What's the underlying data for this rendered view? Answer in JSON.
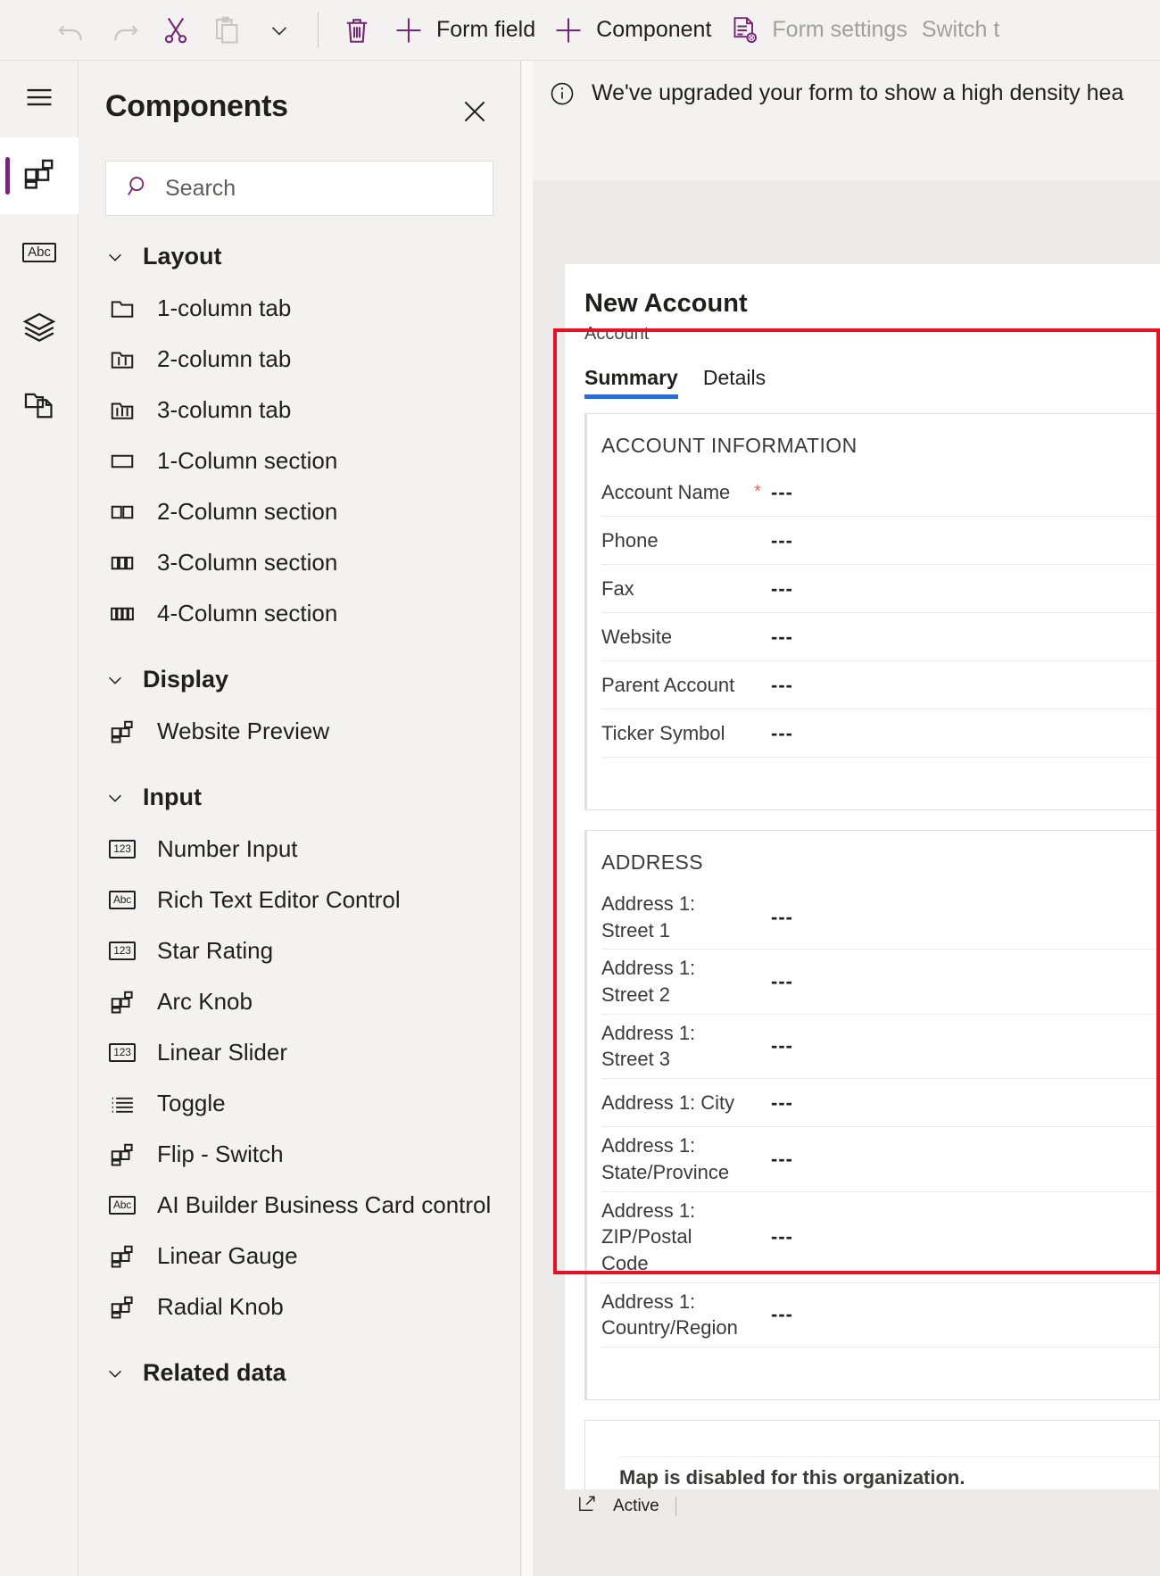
{
  "toolbar": {
    "items": [
      {
        "name": "undo",
        "label": "",
        "icon": "undo-icon",
        "disabled": true
      },
      {
        "name": "redo",
        "label": "",
        "icon": "redo-icon",
        "disabled": true
      },
      {
        "name": "cut",
        "label": "",
        "icon": "scissors-icon",
        "disabled": false
      },
      {
        "name": "paste",
        "label": "",
        "icon": "clipboard-icon",
        "disabled": true
      },
      {
        "name": "overflow",
        "label": "",
        "icon": "chevron-down-icon",
        "disabled": false
      },
      {
        "name": "delete",
        "label": "",
        "icon": "trash-icon",
        "disabled": false
      },
      {
        "name": "form-field",
        "label": "Form field",
        "icon": "plus-icon",
        "disabled": false
      },
      {
        "name": "component",
        "label": "Component",
        "icon": "plus-icon",
        "disabled": false
      },
      {
        "name": "form-settings",
        "label": "Form settings",
        "icon": "form-settings-icon",
        "disabled": true
      },
      {
        "name": "switch",
        "label": "Switch t",
        "icon": "",
        "disabled": true
      }
    ]
  },
  "rail": {
    "items": [
      {
        "name": "menu",
        "icon": "hamburger-icon",
        "selected": false
      },
      {
        "name": "components",
        "icon": "components-grid-icon",
        "selected": true
      },
      {
        "name": "fields",
        "icon": "abc-field-icon",
        "selected": false
      },
      {
        "name": "layers",
        "icon": "layers-icon",
        "selected": false
      },
      {
        "name": "pages",
        "icon": "copy-pages-icon",
        "selected": false
      }
    ]
  },
  "panel": {
    "title": "Components",
    "close_label": "Close",
    "search": {
      "placeholder": "Search",
      "value": ""
    },
    "groups": [
      {
        "title": "Layout",
        "expanded": true,
        "items": [
          {
            "label": "1-column tab",
            "icon": "tab-1col-icon"
          },
          {
            "label": "2-column tab",
            "icon": "tab-2col-icon"
          },
          {
            "label": "3-column tab",
            "icon": "tab-3col-icon"
          },
          {
            "label": "1-Column section",
            "icon": "section-1col-icon"
          },
          {
            "label": "2-Column section",
            "icon": "section-2col-icon"
          },
          {
            "label": "3-Column section",
            "icon": "section-3col-icon"
          },
          {
            "label": "4-Column section",
            "icon": "section-4col-icon"
          }
        ]
      },
      {
        "title": "Display",
        "expanded": true,
        "items": [
          {
            "label": "Website Preview",
            "icon": "components-grid-icon"
          }
        ]
      },
      {
        "title": "Input",
        "expanded": true,
        "items": [
          {
            "label": "Number Input",
            "icon": "number-123-icon"
          },
          {
            "label": "Rich Text Editor Control",
            "icon": "abc-text-icon"
          },
          {
            "label": "Star Rating",
            "icon": "number-123-icon"
          },
          {
            "label": "Arc Knob",
            "icon": "components-grid-icon"
          },
          {
            "label": "Linear Slider",
            "icon": "number-123-icon"
          },
          {
            "label": "Toggle",
            "icon": "list-lines-icon"
          },
          {
            "label": "Flip - Switch",
            "icon": "components-grid-icon"
          },
          {
            "label": "AI Builder Business Card control",
            "icon": "abc-text-icon"
          },
          {
            "label": "Linear Gauge",
            "icon": "components-grid-icon"
          },
          {
            "label": "Radial Knob",
            "icon": "components-grid-icon"
          }
        ]
      },
      {
        "title": "Related data",
        "expanded": true,
        "items": []
      }
    ]
  },
  "canvas": {
    "banner": {
      "icon": "info-icon",
      "text": "We've upgraded your form to show a high density hea"
    },
    "form": {
      "title": "New Account",
      "subtitle": "Account",
      "tabs": [
        {
          "label": "Summary",
          "active": true
        },
        {
          "label": "Details",
          "active": false
        }
      ],
      "sections": [
        {
          "title": "ACCOUNT INFORMATION",
          "fields": [
            {
              "label": "Account Name",
              "value": "---",
              "required": true
            },
            {
              "label": "Phone",
              "value": "---",
              "required": false
            },
            {
              "label": "Fax",
              "value": "---",
              "required": false
            },
            {
              "label": "Website",
              "value": "---",
              "required": false
            },
            {
              "label": "Parent Account",
              "value": "---",
              "required": false
            },
            {
              "label": "Ticker Symbol",
              "value": "---",
              "required": false
            }
          ]
        },
        {
          "title": "ADDRESS",
          "fields": [
            {
              "label": "Address 1: Street 1",
              "value": "---",
              "required": false
            },
            {
              "label": "Address 1: Street 2",
              "value": "---",
              "required": false
            },
            {
              "label": "Address 1: Street 3",
              "value": "---",
              "required": false
            },
            {
              "label": "Address 1: City",
              "value": "---",
              "required": false
            },
            {
              "label": "Address 1: State/Province",
              "value": "---",
              "required": false
            },
            {
              "label": "Address 1: ZIP/Postal Code",
              "value": "---",
              "required": false
            },
            {
              "label": "Address 1: Country/Region",
              "value": "---",
              "required": false
            }
          ]
        }
      ],
      "map_message": "Map is disabled for this organization.",
      "status": {
        "icon": "expand-icon",
        "text": "Active"
      }
    }
  },
  "colors": {
    "accent": "#742774",
    "tab_underline": "#2b6fd4",
    "selection": "#e81123",
    "required": "#e06c5a",
    "chrome": "#f3f2f1"
  }
}
